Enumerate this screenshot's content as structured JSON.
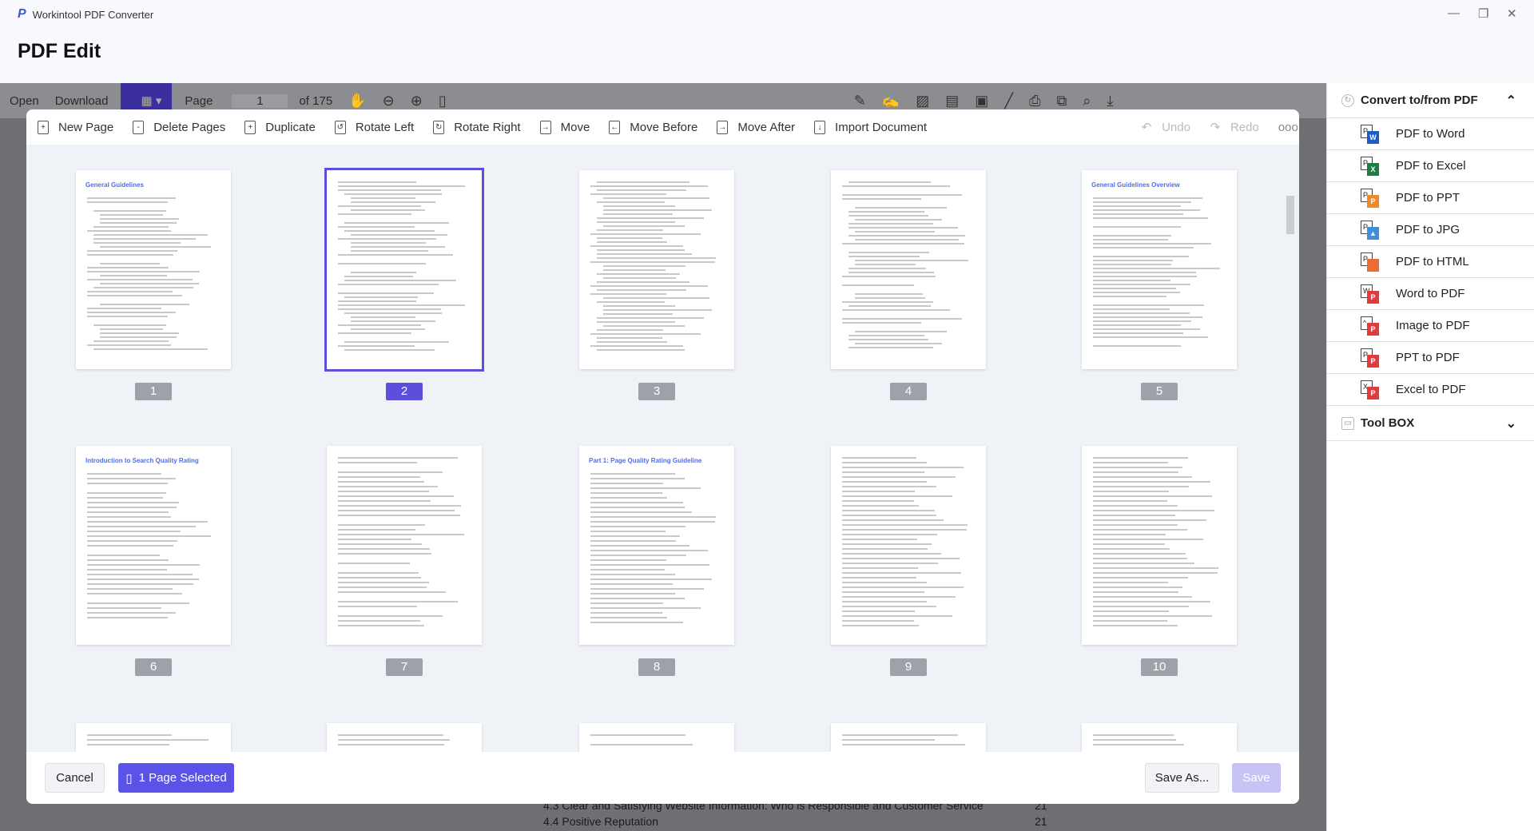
{
  "app": {
    "title": "Workintool PDF Converter",
    "page_title": "PDF Edit"
  },
  "viewer_toolbar": {
    "open": "Open",
    "download": "Download",
    "page_label": "Page",
    "page_value": "1",
    "page_total": "of 175"
  },
  "background_doc": {
    "line1": "4.3 Clear and Satisfying Website Information: Who is Responsible and Customer Service",
    "line1_page": "21",
    "line2": "4.4 Positive Reputation",
    "line2_page": "21"
  },
  "dialog_toolbar": {
    "new_page": "New Page",
    "delete_pages": "Delete Pages",
    "duplicate": "Duplicate",
    "rotate_left": "Rotate Left",
    "rotate_right": "Rotate Right",
    "move": "Move",
    "move_before": "Move Before",
    "move_after": "Move After",
    "import_document": "Import Document",
    "undo": "Undo",
    "redo": "Redo"
  },
  "pages": [
    {
      "label": "1",
      "title": "General Guidelines",
      "selected": false
    },
    {
      "label": "2",
      "title": "",
      "selected": true
    },
    {
      "label": "3",
      "title": "",
      "selected": false
    },
    {
      "label": "4",
      "title": "",
      "selected": false
    },
    {
      "label": "5",
      "title": "General Guidelines Overview",
      "selected": false
    },
    {
      "label": "6",
      "title": "Introduction to Search Quality Rating",
      "selected": false
    },
    {
      "label": "7",
      "title": "",
      "selected": false
    },
    {
      "label": "8",
      "title": "Part 1: Page Quality Rating Guideline",
      "selected": false
    },
    {
      "label": "9",
      "title": "",
      "selected": false
    },
    {
      "label": "10",
      "title": "",
      "selected": false
    },
    {
      "label": "",
      "title": "",
      "selected": false
    },
    {
      "label": "",
      "title": "",
      "selected": false
    },
    {
      "label": "",
      "title": "",
      "selected": false
    },
    {
      "label": "",
      "title": "",
      "selected": false
    },
    {
      "label": "",
      "title": "",
      "selected": false
    }
  ],
  "footer": {
    "cancel": "Cancel",
    "selected": "1 Page Selected",
    "save_as": "Save As...",
    "save": "Save"
  },
  "right_panel": {
    "convert_title": "Convert to/from PDF",
    "items": [
      {
        "label": "PDF to Word",
        "src": "P",
        "badge": "W",
        "color": "#1f5bc6"
      },
      {
        "label": "PDF to Excel",
        "src": "P",
        "badge": "X",
        "color": "#1e7d43"
      },
      {
        "label": "PDF to PPT",
        "src": "P",
        "badge": "P",
        "color": "#f08a24"
      },
      {
        "label": "PDF to JPG",
        "src": "P",
        "badge": "▲",
        "color": "#3d8fe0"
      },
      {
        "label": "PDF to HTML",
        "src": "P",
        "badge": "</>",
        "color": "#ef6b35"
      },
      {
        "label": "Word to PDF",
        "src": "W",
        "badge": "P",
        "color": "#e53a3a"
      },
      {
        "label": "Image to PDF",
        "src": "^",
        "badge": "P",
        "color": "#e53a3a"
      },
      {
        "label": "PPT to PDF",
        "src": "P",
        "badge": "P",
        "color": "#e53a3a"
      },
      {
        "label": "Excel to PDF",
        "src": "X",
        "badge": "P",
        "color": "#e53a3a"
      }
    ],
    "toolbox_title": "Tool BOX"
  },
  "colors": {
    "accent": "#5b52e8",
    "selected_outline": "#5b4fdc"
  }
}
